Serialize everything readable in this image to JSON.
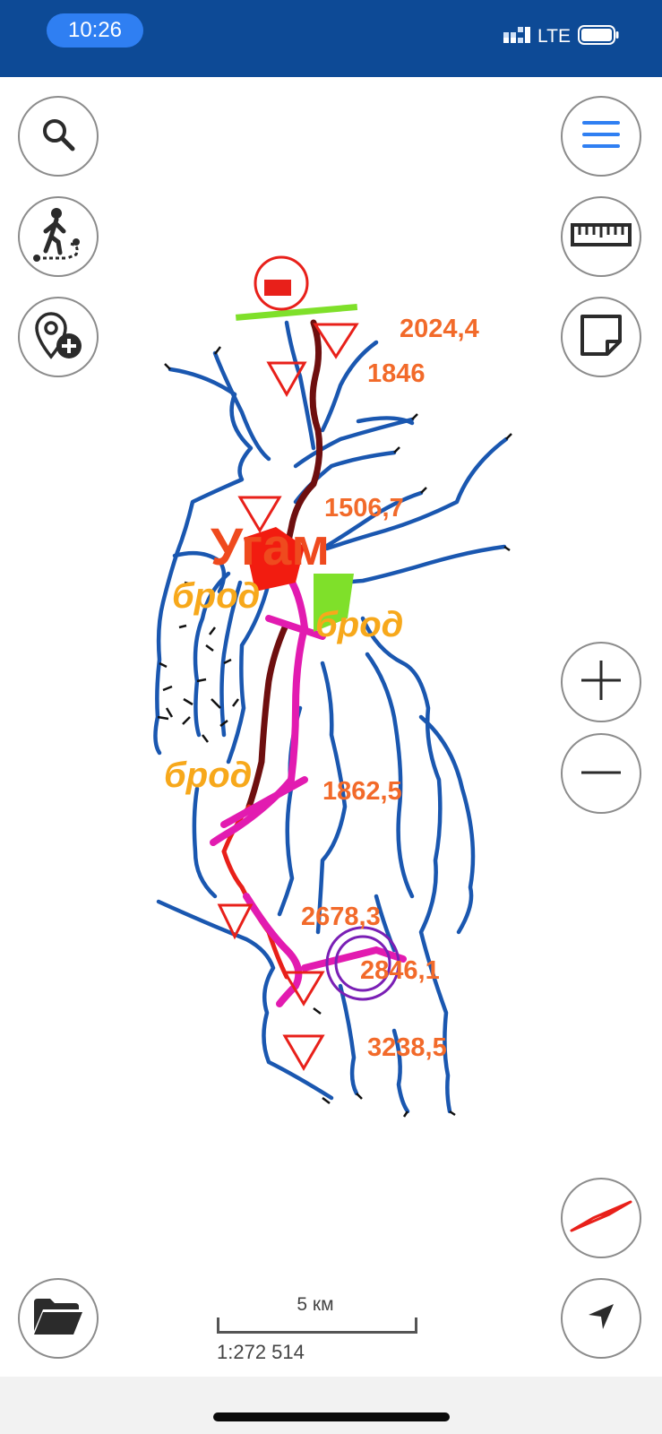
{
  "status_bar": {
    "time": "10:26",
    "network": "LTE"
  },
  "map": {
    "place_label": "Угам",
    "ford_labels": [
      "брод",
      "брод",
      "брод"
    ],
    "peaks": [
      "2024,4",
      "1846",
      "1506,7",
      "1862,5",
      "2678,3",
      "2846,1",
      "3238,5"
    ],
    "colors": {
      "river": "#1a57b0",
      "trail_dark": "#6e0f0f",
      "trail_red": "#e8201a",
      "track_magenta": "#e21bb0",
      "accent": "#2f7ff2"
    }
  },
  "scale": {
    "label": "5 км",
    "ratio": "1:272 514"
  },
  "controls": {
    "left": [
      "search-icon",
      "hiker-route-icon",
      "add-place-icon",
      "folder-icon"
    ],
    "right": [
      "menu-icon",
      "ruler-icon",
      "note-icon",
      "zoom-in-icon",
      "zoom-out-icon",
      "compass-icon",
      "navigation-arrow-icon"
    ]
  }
}
